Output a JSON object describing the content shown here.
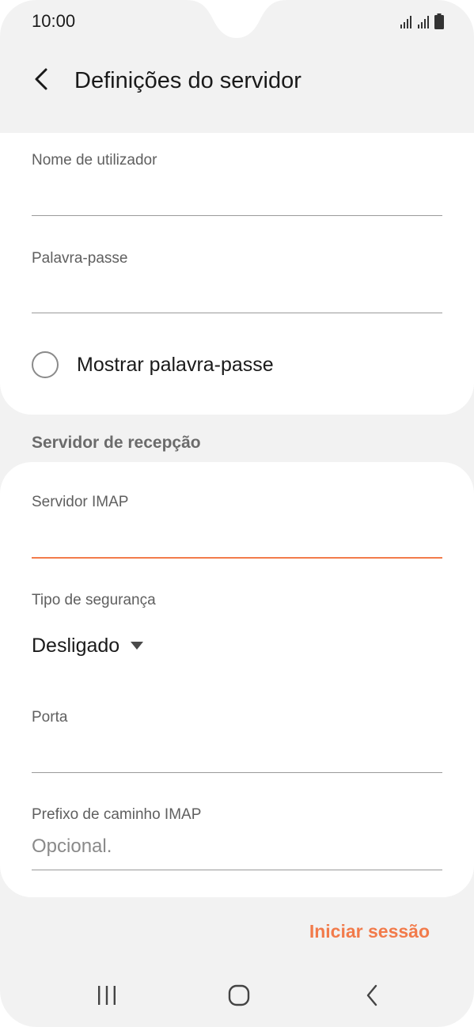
{
  "status_bar": {
    "time": "10:00",
    "icons": [
      "signal-icon",
      "signal-icon",
      "battery-icon"
    ]
  },
  "header": {
    "back_icon": "back-arrow-icon",
    "title": "Definições do servidor"
  },
  "account": {
    "username_label": "Nome de utilizador",
    "username_value": "",
    "password_label": "Palavra-passe",
    "password_value": "",
    "show_password_label": "Mostrar palavra-passe",
    "show_password_checked": false
  },
  "incoming": {
    "section_title": "Servidor de recepção",
    "imap_server_label": "Servidor IMAP",
    "imap_server_value": "",
    "security_type_label": "Tipo de segurança",
    "security_type_value": "Desligado",
    "port_label": "Porta",
    "port_value": "",
    "imap_prefix_label": "Prefixo de caminho IMAP",
    "imap_prefix_placeholder": "Opcional."
  },
  "actions": {
    "sign_in_label": "Iniciar sessão"
  },
  "nav_bar": {
    "icons": [
      "recent-apps-icon",
      "home-icon",
      "back-icon"
    ]
  },
  "colors": {
    "accent": "#f27b4b",
    "background": "#f2f2f2",
    "card": "#ffffff"
  }
}
